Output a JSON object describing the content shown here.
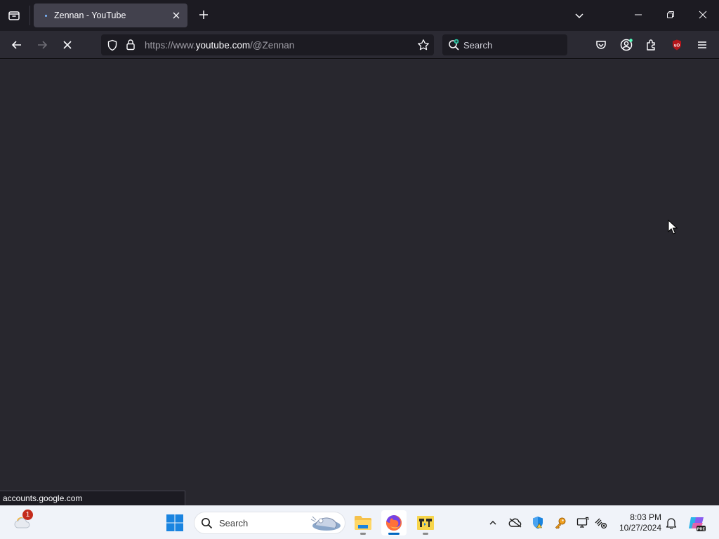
{
  "browser": {
    "tab": {
      "title": "Zennan - YouTube"
    },
    "url": {
      "prefix": "https://www.",
      "host": "youtube.com",
      "path": "/@Zennan"
    },
    "search_placeholder": "Search",
    "status_text": "accounts.google.com"
  },
  "taskbar": {
    "search_placeholder": "Search",
    "weather_badge": "1",
    "clock": {
      "time": "8:03 PM",
      "date": "10/27/2024"
    }
  },
  "colors": {
    "content_bg": "#28272e",
    "toolbar_bg": "#2b2a33",
    "tabstrip_bg": "#1c1b22",
    "accent": "#0067c0",
    "ublock_red": "#b5161b"
  },
  "icons": [
    "tab-list-icon",
    "close-icon",
    "plus-icon",
    "chevron-down-icon",
    "minimize-icon",
    "restore-icon",
    "window-close-icon",
    "arrow-left-icon",
    "arrow-right-icon",
    "stop-loading-icon",
    "shield-icon",
    "lock-icon",
    "star-icon",
    "search-icon",
    "pocket-icon",
    "account-icon",
    "extensions-icon",
    "ublock-icon",
    "hamburger-menu-icon",
    "weather-icon",
    "windows-start-icon",
    "file-explorer-icon",
    "firefox-icon",
    "app-icon",
    "chevron-up-icon",
    "onedrive-icon",
    "defender-icon",
    "key-icon",
    "display-icon",
    "network-icon",
    "bell-icon",
    "copilot-icon",
    "mouse-cursor-icon"
  ]
}
